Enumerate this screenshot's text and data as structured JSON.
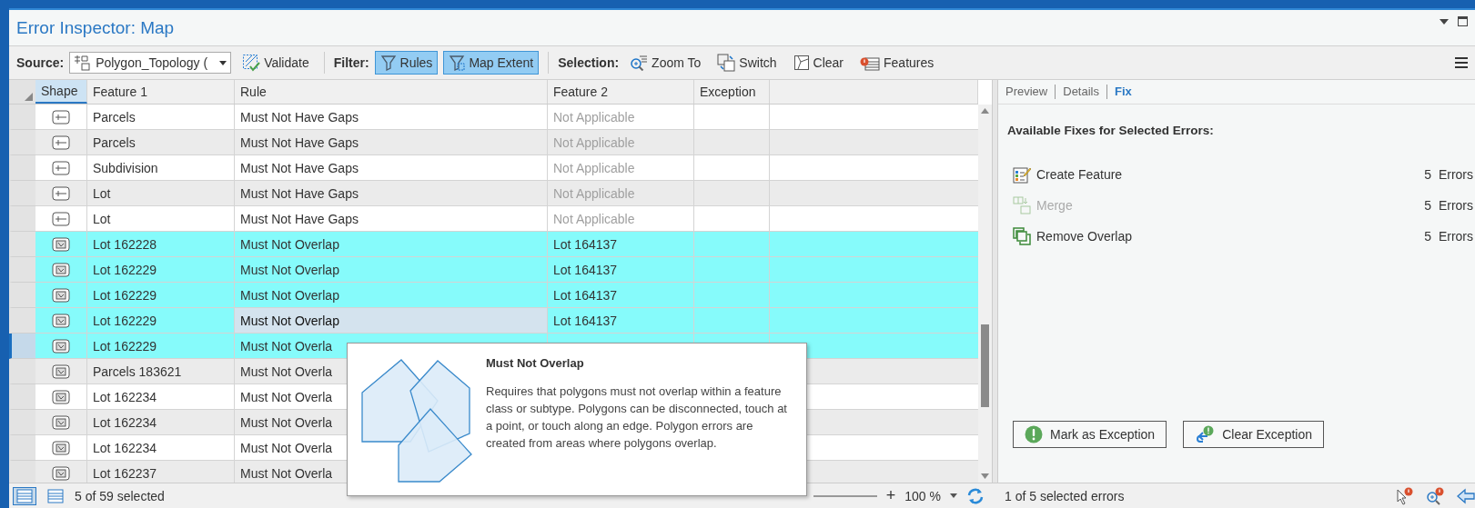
{
  "window": {
    "title": "Error Inspector: Map"
  },
  "toolbar": {
    "source_label": "Source:",
    "source_value": "Polygon_Topology (",
    "validate": "Validate",
    "filter_label": "Filter:",
    "filters": [
      {
        "label": "Rules",
        "on": true
      },
      {
        "label": "Map Extent",
        "on": true
      }
    ],
    "selection_label": "Selection:",
    "selection_tools": [
      {
        "kind": "zoom",
        "label": "Zoom To"
      },
      {
        "kind": "switch",
        "label": "Switch"
      },
      {
        "kind": "clear",
        "label": "Clear"
      },
      {
        "kind": "features",
        "label": "Features"
      }
    ]
  },
  "table": {
    "columns": [
      {
        "label": "Shape",
        "selected": true
      },
      {
        "label": "Feature 1",
        "selected": false
      },
      {
        "label": "Rule",
        "selected": false
      },
      {
        "label": "Feature 2",
        "selected": false
      },
      {
        "label": "Exception",
        "selected": false
      }
    ],
    "rows": [
      {
        "kind": "line",
        "feature_1": "Parcels",
        "rule": "Must Not Have Gaps",
        "feature_2": "Not Applicable",
        "feature_2_greyed": true,
        "selected": false,
        "current": false,
        "cell_focused": false
      },
      {
        "kind": "line",
        "feature_1": "Parcels",
        "rule": "Must Not Have Gaps",
        "feature_2": "Not Applicable",
        "feature_2_greyed": true,
        "selected": false,
        "current": false,
        "cell_focused": false
      },
      {
        "kind": "line",
        "feature_1": "Subdivision",
        "rule": "Must Not Have Gaps",
        "feature_2": "Not Applicable",
        "feature_2_greyed": true,
        "selected": false,
        "current": false,
        "cell_focused": false
      },
      {
        "kind": "line",
        "feature_1": "Lot",
        "rule": "Must Not Have Gaps",
        "feature_2": "Not Applicable",
        "feature_2_greyed": true,
        "selected": false,
        "current": false,
        "cell_focused": false
      },
      {
        "kind": "line",
        "feature_1": "Lot",
        "rule": "Must Not Have Gaps",
        "feature_2": "Not Applicable",
        "feature_2_greyed": true,
        "selected": false,
        "current": false,
        "cell_focused": false
      },
      {
        "kind": "polygon",
        "feature_1": "Lot 162228",
        "rule": "Must Not Overlap",
        "feature_2": "Lot 164137",
        "feature_2_greyed": false,
        "selected": true,
        "current": false,
        "cell_focused": false
      },
      {
        "kind": "polygon",
        "feature_1": "Lot 162229",
        "rule": "Must Not Overlap",
        "feature_2": "Lot 164137",
        "feature_2_greyed": false,
        "selected": true,
        "current": false,
        "cell_focused": false
      },
      {
        "kind": "polygon",
        "feature_1": "Lot 162229",
        "rule": "Must Not Overlap",
        "feature_2": "Lot 164137",
        "feature_2_greyed": false,
        "selected": true,
        "current": false,
        "cell_focused": false
      },
      {
        "kind": "polygon",
        "feature_1": "Lot 162229",
        "rule": "Must Not Overlap",
        "feature_2": "Lot 164137",
        "feature_2_greyed": false,
        "selected": true,
        "current": false,
        "cell_focused": true
      },
      {
        "kind": "polygon",
        "feature_1": "Lot 162229",
        "rule": "Must Not Overla",
        "selected": true,
        "current": true,
        "cell_focused": false
      },
      {
        "kind": "polygon",
        "feature_1": "Parcels 183621",
        "rule": "Must Not Overla",
        "selected": false,
        "current": false,
        "cell_focused": false
      },
      {
        "kind": "polygon",
        "feature_1": "Lot 162234",
        "rule": "Must Not Overla",
        "selected": false,
        "current": false,
        "cell_focused": false
      },
      {
        "kind": "polygon",
        "feature_1": "Lot 162234",
        "rule": "Must Not Overla",
        "selected": false,
        "current": false,
        "cell_focused": false
      },
      {
        "kind": "polygon",
        "feature_1": "Lot 162234",
        "rule": "Must Not Overla",
        "selected": false,
        "current": false,
        "cell_focused": false
      },
      {
        "kind": "polygon",
        "feature_1": "Lot 162237",
        "rule": "Must Not Overla",
        "selected": false,
        "current": false,
        "cell_focused": false
      }
    ]
  },
  "tooltip": {
    "title": "Must Not Overlap",
    "text": "Requires that polygons must not overlap within a feature class or subtype. Polygons can be disconnected, touch at a point, or touch along an edge. Polygon errors are created from areas where polygons overlap."
  },
  "panel": {
    "tabs": [
      {
        "label": "Preview",
        "selected": false
      },
      {
        "label": "Details",
        "selected": false
      },
      {
        "label": "Fix",
        "selected": true
      }
    ],
    "heading": "Available Fixes for Selected Errors:",
    "fixes": [
      {
        "kind": "create",
        "label": "Create Feature",
        "count": "5  Errors",
        "disabled": false
      },
      {
        "kind": "merge",
        "label": "Merge",
        "count": "5  Errors",
        "disabled": true
      },
      {
        "kind": "remove",
        "label": "Remove Overlap",
        "count": "5  Errors",
        "disabled": false
      }
    ],
    "buttons": [
      {
        "kind": "mark",
        "label": "Mark as Exception"
      },
      {
        "kind": "clear",
        "label": "Clear Exception"
      }
    ]
  },
  "status_bar": {
    "views": [
      {
        "selected": true
      },
      {
        "selected": false
      }
    ],
    "selection_count": "5 of 59 selected",
    "zoom_in": "+",
    "zoom": "100 %",
    "errors": "1 of 5 selected errors"
  }
}
